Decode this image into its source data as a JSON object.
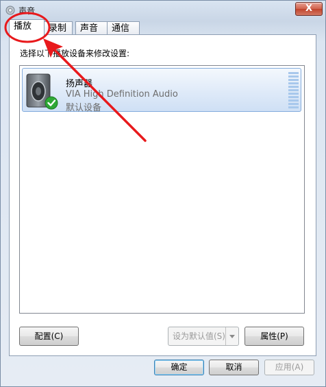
{
  "window": {
    "title": "声音",
    "close_label": "X"
  },
  "tabs": [
    {
      "label": "播放",
      "active": true
    },
    {
      "label": "录制",
      "active": false
    },
    {
      "label": "声音",
      "active": false
    },
    {
      "label": "通信",
      "active": false
    }
  ],
  "playback": {
    "instruction": "选择以下播放设备来修改设置:",
    "devices": [
      {
        "name": "扬声器",
        "driver": "VIA High Definition Audio",
        "status": "默认设备",
        "icon": "speaker-icon",
        "badge": "green-check-icon"
      }
    ]
  },
  "buttons": {
    "configure": "配置(C)",
    "set_default": "设为默认值(S)",
    "properties": "属性(P)",
    "ok": "确定",
    "cancel": "取消",
    "apply": "应用(A)"
  },
  "colors": {
    "annotation": "#e8191c",
    "selection": "#cfe0f5",
    "check": "#2ea836"
  }
}
